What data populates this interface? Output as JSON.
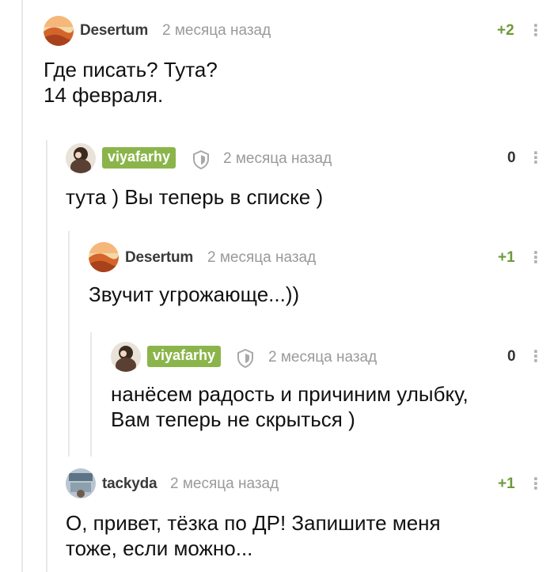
{
  "comments": [
    {
      "author": "Desertum",
      "time": "2 месяца назад",
      "rating": "+2",
      "menu": "⋮",
      "text": "Где писать? Тута?\n14 февраля."
    },
    {
      "author": "viyafarhy",
      "time": "2 месяца назад",
      "rating": "0",
      "menu": "⋮",
      "text": "тута ) Вы теперь в списке )"
    },
    {
      "author": "Desertum",
      "time": "2 месяца назад",
      "rating": "+1",
      "menu": "⋮",
      "text": "Звучит угрожающе...))"
    },
    {
      "author": "viyafarhy",
      "time": "2 месяца назад",
      "rating": "0",
      "menu": "⋮",
      "text": "нанёсем радость и причиним улыбку,\nВам теперь не скрыться )"
    },
    {
      "author": "tackyda",
      "time": "2 месяца назад",
      "rating": "+1",
      "menu": "⋮",
      "text": "О, привет, тёзка по ДР! Запишите меня\nтоже, если можно..."
    }
  ],
  "colors": {
    "author_badge": "#8bb54b",
    "rating_positive": "#6c9a3a",
    "time": "#9a9a9a",
    "thread_line": "#e8e8e8"
  },
  "icons": {
    "desertum_avatar": "desert-avatar-icon",
    "viyafarhy_avatar": "user-photo-avatar-icon",
    "tackyda_avatar": "user-photo-avatar-icon",
    "shield": "shield-icon",
    "menu": "more-vertical-icon"
  }
}
